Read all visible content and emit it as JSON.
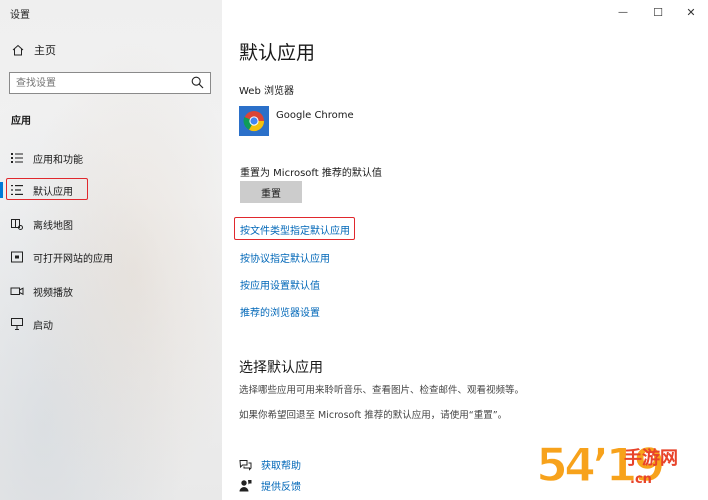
{
  "window": {
    "title": "设置",
    "controls": {
      "minimize": "—",
      "maximize": "☐",
      "close": "✕"
    }
  },
  "sidebar": {
    "home_label": "主页",
    "search": {
      "placeholder": "查找设置"
    },
    "section": "应用",
    "items": [
      {
        "label": "应用和功能",
        "icon": "apps-list-icon"
      },
      {
        "label": "默认应用",
        "icon": "default-apps-icon",
        "active": true
      },
      {
        "label": "离线地图",
        "icon": "map-icon"
      },
      {
        "label": "可打开网站的应用",
        "icon": "open-website-icon"
      },
      {
        "label": "视频播放",
        "icon": "video-icon"
      },
      {
        "label": "启动",
        "icon": "startup-icon"
      }
    ]
  },
  "main": {
    "title": "默认应用",
    "web_browser": {
      "label": "Web 浏览器",
      "app_name": "Google Chrome"
    },
    "reset": {
      "label": "重置为 Microsoft 推荐的默认值",
      "button": "重置"
    },
    "links": [
      "按文件类型指定默认应用",
      "按协议指定默认应用",
      "按应用设置默认值",
      "推荐的浏览器设置"
    ],
    "choose": {
      "heading": "选择默认应用",
      "desc1": "选择哪些应用可用来聆听音乐、查看图片、检查邮件、观看视频等。",
      "desc2": "如果你希望回退至 Microsoft 推荐的默认应用，请使用“重置”。"
    },
    "help": {
      "get_help": "获取帮助",
      "feedback": "提供反馈"
    }
  },
  "watermark": {
    "number": "54’19",
    "text1": "手游网",
    "text2": ".cn"
  },
  "colors": {
    "accent": "#0078d7",
    "link": "#0067b8",
    "highlight": "#e0282d"
  }
}
